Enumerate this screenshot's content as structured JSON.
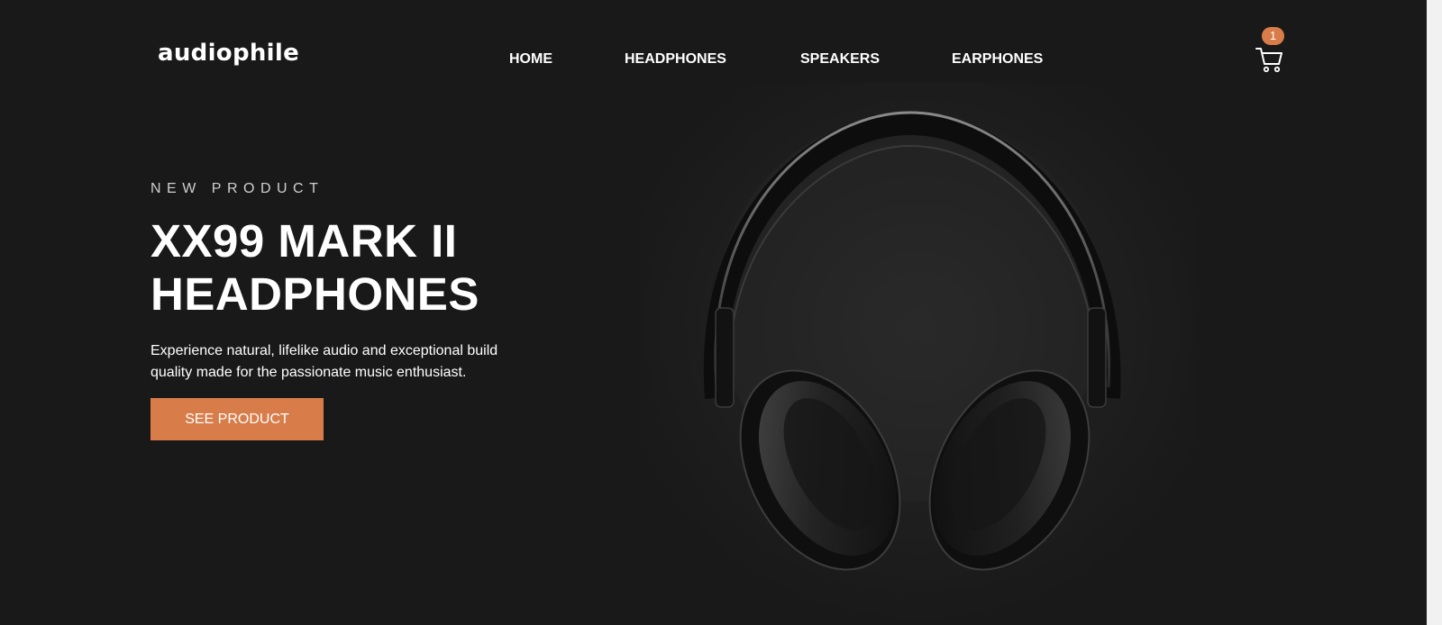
{
  "header": {
    "logo": "audiophile",
    "nav": [
      {
        "label": "HOME"
      },
      {
        "label": "HEADPHONES"
      },
      {
        "label": "SPEAKERS"
      },
      {
        "label": "EARPHONES"
      }
    ],
    "cart": {
      "count": "1",
      "icon": "shopping-cart-icon"
    }
  },
  "hero": {
    "overline": "NEW PRODUCT",
    "title_line1": "XX99 MARK II",
    "title_line2": "HEADPHONES",
    "description": "Experience natural, lifelike audio and exceptional build quality made for the passionate music enthusiast.",
    "cta_label": "SEE PRODUCT"
  },
  "colors": {
    "background": "#191919",
    "accent": "#d87d4a",
    "text": "#ffffff"
  }
}
